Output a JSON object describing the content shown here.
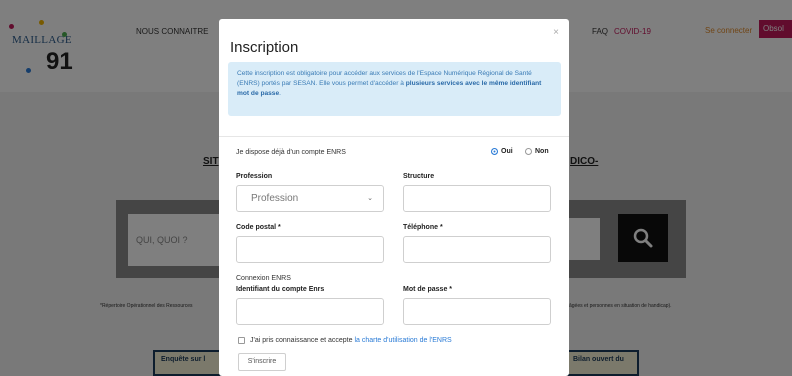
{
  "logo": {
    "text": "MAILLAGE",
    "number": "91"
  },
  "nav": {
    "nous_connaitre": "NOUS CONNAITRE",
    "faq": "FAQ",
    "covid": "COVID-19",
    "login": "Se connecter",
    "register": "Obsol"
  },
  "background": {
    "link_left": "SIT",
    "link_right": "DICO-",
    "search_placeholder": "QUI, QUOI ?",
    "footnote_left": "*Répertoire Opérationnel des Ressources",
    "footnote_right": "âgées et personnes en situation de handicap).",
    "box_left": "Enquête sur l",
    "box_right": "Bilan ouvert du"
  },
  "modal": {
    "title": "Inscription",
    "close": "×",
    "alert_text": "Cette inscription est obligatoire pour accéder aux services de l'Espace Numérique Régional de Santé (ENRS) portés par SESAN. Elle vous permet d'accéder à ",
    "alert_bold": "plusieurs services avec le même identifiant mot de passe",
    "alert_end": ".",
    "account_question": "Je dispose déjà d'un compte ENRS",
    "radio_yes": "Oui",
    "radio_no": "Non",
    "profession_label": "Profession",
    "profession_value": "Profession",
    "structure_label": "Structure",
    "postal_label": "Code postal *",
    "phone_label": "Téléphone *",
    "connexion_label": "Connexion ENRS",
    "identifier_label": "Identifiant du compte Enrs",
    "password_label": "Mot de passe *",
    "accept_text": "J'ai pris connaissance et accepte ",
    "accept_link": "la charte d'utilisation de l'ENRS",
    "submit": "S'inscrire"
  },
  "colors": {
    "accent": "#2a7bd6",
    "brand": "#c2185b",
    "alert_bg": "#d9ecf8"
  },
  "icons": {
    "search": "search-icon",
    "caret": "chevron-down-icon"
  }
}
